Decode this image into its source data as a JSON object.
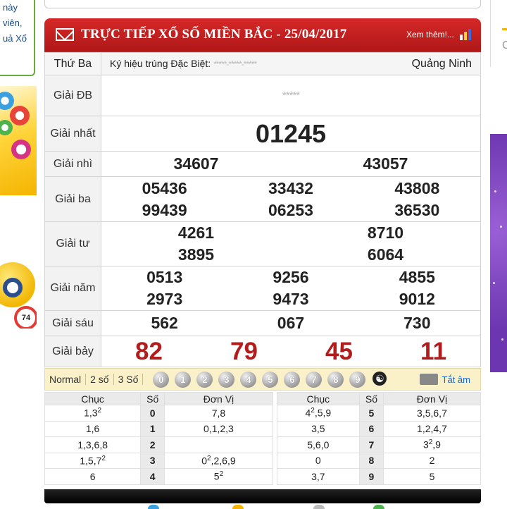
{
  "left_sidebar": {
    "lines": [
      "này",
      "viên,",
      "uả Xổ"
    ]
  },
  "header": {
    "title": "TRỰC TIẾP XỔ SỐ MIỀN BẮC - 25/04/2017",
    "more_link": "Xem thêm!..."
  },
  "info": {
    "weekday": "Thứ Ba",
    "special_code_label": "Ký hiệu trúng Đặc Biệt:",
    "special_code_value": "*****-*****-*****",
    "province": "Quảng Ninh"
  },
  "prizes": {
    "db": {
      "label": "Giải ĐB",
      "value": "*****"
    },
    "g1": {
      "label": "Giải nhất",
      "values": [
        "01245"
      ]
    },
    "g2": {
      "label": "Giải nhì",
      "values": [
        "34607",
        "43057"
      ]
    },
    "g3": {
      "label": "Giải ba",
      "values": [
        "05436",
        "33432",
        "43808",
        "99439",
        "06253",
        "36530"
      ]
    },
    "g4": {
      "label": "Giải tư",
      "values": [
        "4261",
        "8710",
        "3895",
        "6064"
      ]
    },
    "g5": {
      "label": "Giải năm",
      "values": [
        "0513",
        "9256",
        "4855",
        "2973",
        "9473",
        "9012"
      ]
    },
    "g6": {
      "label": "Giải sáu",
      "values": [
        "562",
        "067",
        "730"
      ]
    },
    "g7": {
      "label": "Giải bảy",
      "values": [
        "82",
        "79",
        "45",
        "11"
      ]
    }
  },
  "filter": {
    "options": [
      "Normal",
      "2 số",
      "3 Số"
    ],
    "digits": [
      "0",
      "1",
      "2",
      "3",
      "4",
      "5",
      "6",
      "7",
      "8",
      "9"
    ],
    "yinyang": "☯",
    "sound_label": "Tắt âm"
  },
  "loto": {
    "headers": [
      "Chục",
      "Số",
      "Đơn Vị"
    ],
    "rows": [
      {
        "l_chuc": "1,3",
        "l_chuc_sup": "2",
        "l_so": "0",
        "l_dv": "7,8",
        "l_dv_sup": "",
        "r_chuc": "4",
        "r_chuc_sup": "2",
        "r_chuc_tail": ",5,9",
        "r_so": "5",
        "r_dv": "3,5,6,7"
      },
      {
        "l_chuc": "1,6",
        "l_chuc_sup": "",
        "l_so": "1",
        "l_dv": "0,1,2,3",
        "l_dv_sup": "",
        "r_chuc": "3,5",
        "r_chuc_sup": "",
        "r_chuc_tail": "",
        "r_so": "6",
        "r_dv": "1,2,4,7"
      },
      {
        "l_chuc": "1,3,6,8",
        "l_chuc_sup": "",
        "l_so": "2",
        "l_dv": "",
        "l_dv_sup": "",
        "r_chuc": "5,6,0",
        "r_chuc_sup": "",
        "r_chuc_tail": "",
        "r_so": "7",
        "r_dv": "3",
        "r_dv_sup": "2",
        "r_dv_tail": ",9"
      },
      {
        "l_chuc": "1,5,7",
        "l_chuc_sup": "2",
        "l_so": "3",
        "l_dv": "0",
        "l_dv_sup": "2",
        "l_dv_tail": ",2,6,9",
        "r_chuc": "0",
        "r_chuc_sup": "",
        "r_chuc_tail": "",
        "r_so": "8",
        "r_dv": "2"
      },
      {
        "l_chuc": "6",
        "l_chuc_sup": "",
        "l_so": "4",
        "l_dv": "5",
        "l_dv_sup": "2",
        "r_chuc": "3,7",
        "r_chuc_sup": "",
        "r_chuc_tail": "",
        "r_so": "9",
        "r_dv": "5"
      }
    ]
  },
  "colors": {
    "header_red": "#c42020",
    "g7_red": "#b21c1c",
    "filter_bg": "#fbf1c8",
    "sidebar_green": "#6aaa3a"
  }
}
